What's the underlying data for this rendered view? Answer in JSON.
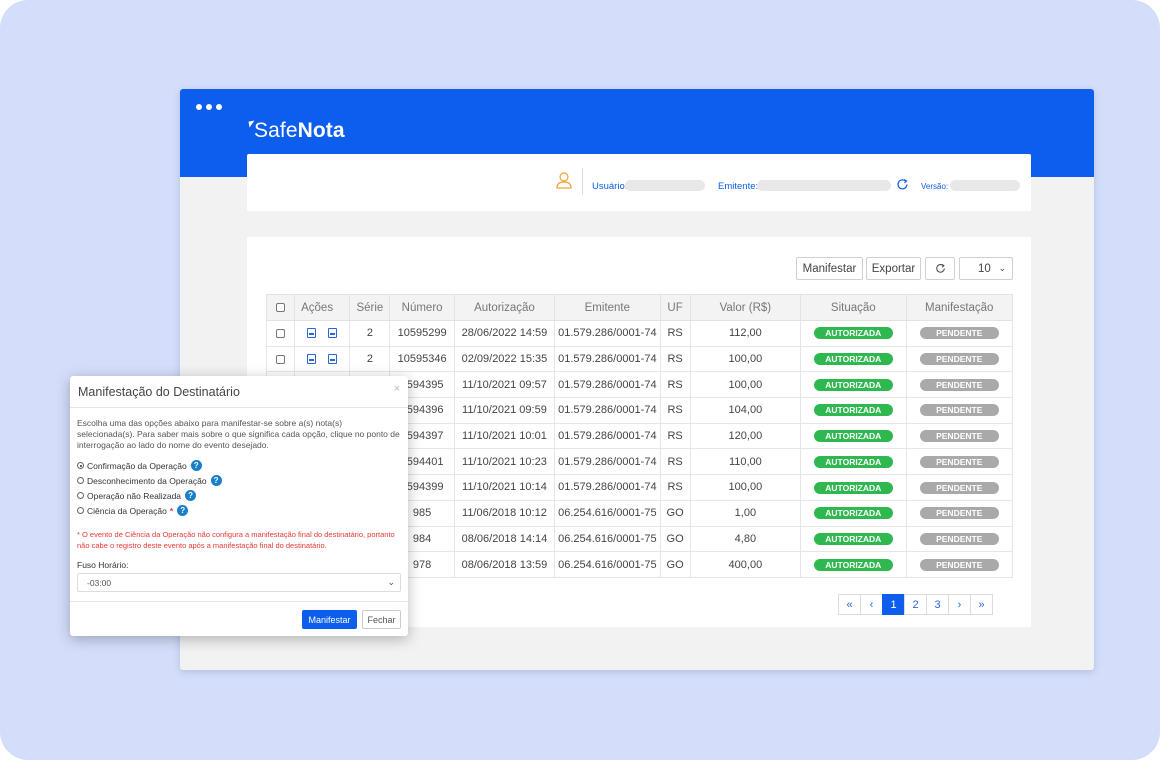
{
  "app": {
    "logo_prefix": "Safe",
    "logo_suffix": "Nota"
  },
  "user_bar": {
    "usuario_label": "Usuário:",
    "emitente_label": "Emitente:",
    "versao_label": "Versão:"
  },
  "toolbar": {
    "manifestar_label": "Manifestar",
    "exportar_label": "Exportar",
    "page_size": "10"
  },
  "table": {
    "headers": [
      "Ações",
      "Série",
      "Número",
      "Autorização",
      "Emitente",
      "UF",
      "Valor (R$)",
      "Situação",
      "Manifestação"
    ],
    "rows": [
      {
        "serie": "2",
        "numero": "10595299",
        "autorizacao": "28/06/2022 14:59",
        "emitente": "01.579.286/0001-74",
        "uf": "RS",
        "valor": "112,00",
        "situacao": "AUTORIZADA",
        "manifestacao": "PENDENTE"
      },
      {
        "serie": "2",
        "numero": "10595346",
        "autorizacao": "02/09/2022 15:35",
        "emitente": "01.579.286/0001-74",
        "uf": "RS",
        "valor": "100,00",
        "situacao": "AUTORIZADA",
        "manifestacao": "PENDENTE"
      },
      {
        "serie": "",
        "numero": "0594395",
        "autorizacao": "11/10/2021 09:57",
        "emitente": "01.579.286/0001-74",
        "uf": "RS",
        "valor": "100,00",
        "situacao": "AUTORIZADA",
        "manifestacao": "PENDENTE"
      },
      {
        "serie": "",
        "numero": "0594396",
        "autorizacao": "11/10/2021 09:59",
        "emitente": "01.579.286/0001-74",
        "uf": "RS",
        "valor": "104,00",
        "situacao": "AUTORIZADA",
        "manifestacao": "PENDENTE"
      },
      {
        "serie": "",
        "numero": "0594397",
        "autorizacao": "11/10/2021 10:01",
        "emitente": "01.579.286/0001-74",
        "uf": "RS",
        "valor": "120,00",
        "situacao": "AUTORIZADA",
        "manifestacao": "PENDENTE"
      },
      {
        "serie": "",
        "numero": "0594401",
        "autorizacao": "11/10/2021 10:23",
        "emitente": "01.579.286/0001-74",
        "uf": "RS",
        "valor": "110,00",
        "situacao": "AUTORIZADA",
        "manifestacao": "PENDENTE"
      },
      {
        "serie": "",
        "numero": "0594399",
        "autorizacao": "11/10/2021 10:14",
        "emitente": "01.579.286/0001-74",
        "uf": "RS",
        "valor": "100,00",
        "situacao": "AUTORIZADA",
        "manifestacao": "PENDENTE"
      },
      {
        "serie": "",
        "numero": "985",
        "autorizacao": "11/06/2018 10:12",
        "emitente": "06.254.616/0001-75",
        "uf": "GO",
        "valor": "1,00",
        "situacao": "AUTORIZADA",
        "manifestacao": "PENDENTE"
      },
      {
        "serie": "",
        "numero": "984",
        "autorizacao": "08/06/2018 14:14",
        "emitente": "06.254.616/0001-75",
        "uf": "GO",
        "valor": "4,80",
        "situacao": "AUTORIZADA",
        "manifestacao": "PENDENTE"
      },
      {
        "serie": "",
        "numero": "978",
        "autorizacao": "08/06/2018 13:59",
        "emitente": "06.254.616/0001-75",
        "uf": "GO",
        "valor": "400,00",
        "situacao": "AUTORIZADA",
        "manifestacao": "PENDENTE"
      }
    ]
  },
  "pagination": {
    "first": "«",
    "prev": "‹",
    "pages": [
      "1",
      "2",
      "3"
    ],
    "current": "1",
    "next": "›",
    "last": "»"
  },
  "modal": {
    "title": "Manifestação do Destinatário",
    "close": "×",
    "description": "Escolha uma das opções abaixo para manifestar-se sobre a(s) nota(s) selecionada(s). Para saber mais sobre o que significa cada opção, clique no ponto de interrogação ao lado do nome do evento desejado.",
    "options": [
      {
        "label": "Confirmação da Operação",
        "selected": true,
        "required": false
      },
      {
        "label": "Desconhecimento da Operação",
        "selected": false,
        "required": false
      },
      {
        "label": "Operação não Realizada",
        "selected": false,
        "required": false
      },
      {
        "label": "Ciência da Operação",
        "selected": false,
        "required": true
      }
    ],
    "help_symbol": "?",
    "required_symbol": "*",
    "warning": "* O evento de Ciência da Operação não configura a manifestação final do destinatário, portanto não cabe o registro deste evento após a manifestação final do destinatário.",
    "fuso_label": "Fuso Horário:",
    "fuso_value": "-03:00",
    "primary_button": "Manifestar",
    "secondary_button": "Fechar"
  },
  "colors": {
    "brand_blue": "#0d5eed",
    "background": "#d4defb",
    "status_green": "#2fb84f",
    "status_gray": "#a9a9a9",
    "warning_red": "#e53935"
  }
}
